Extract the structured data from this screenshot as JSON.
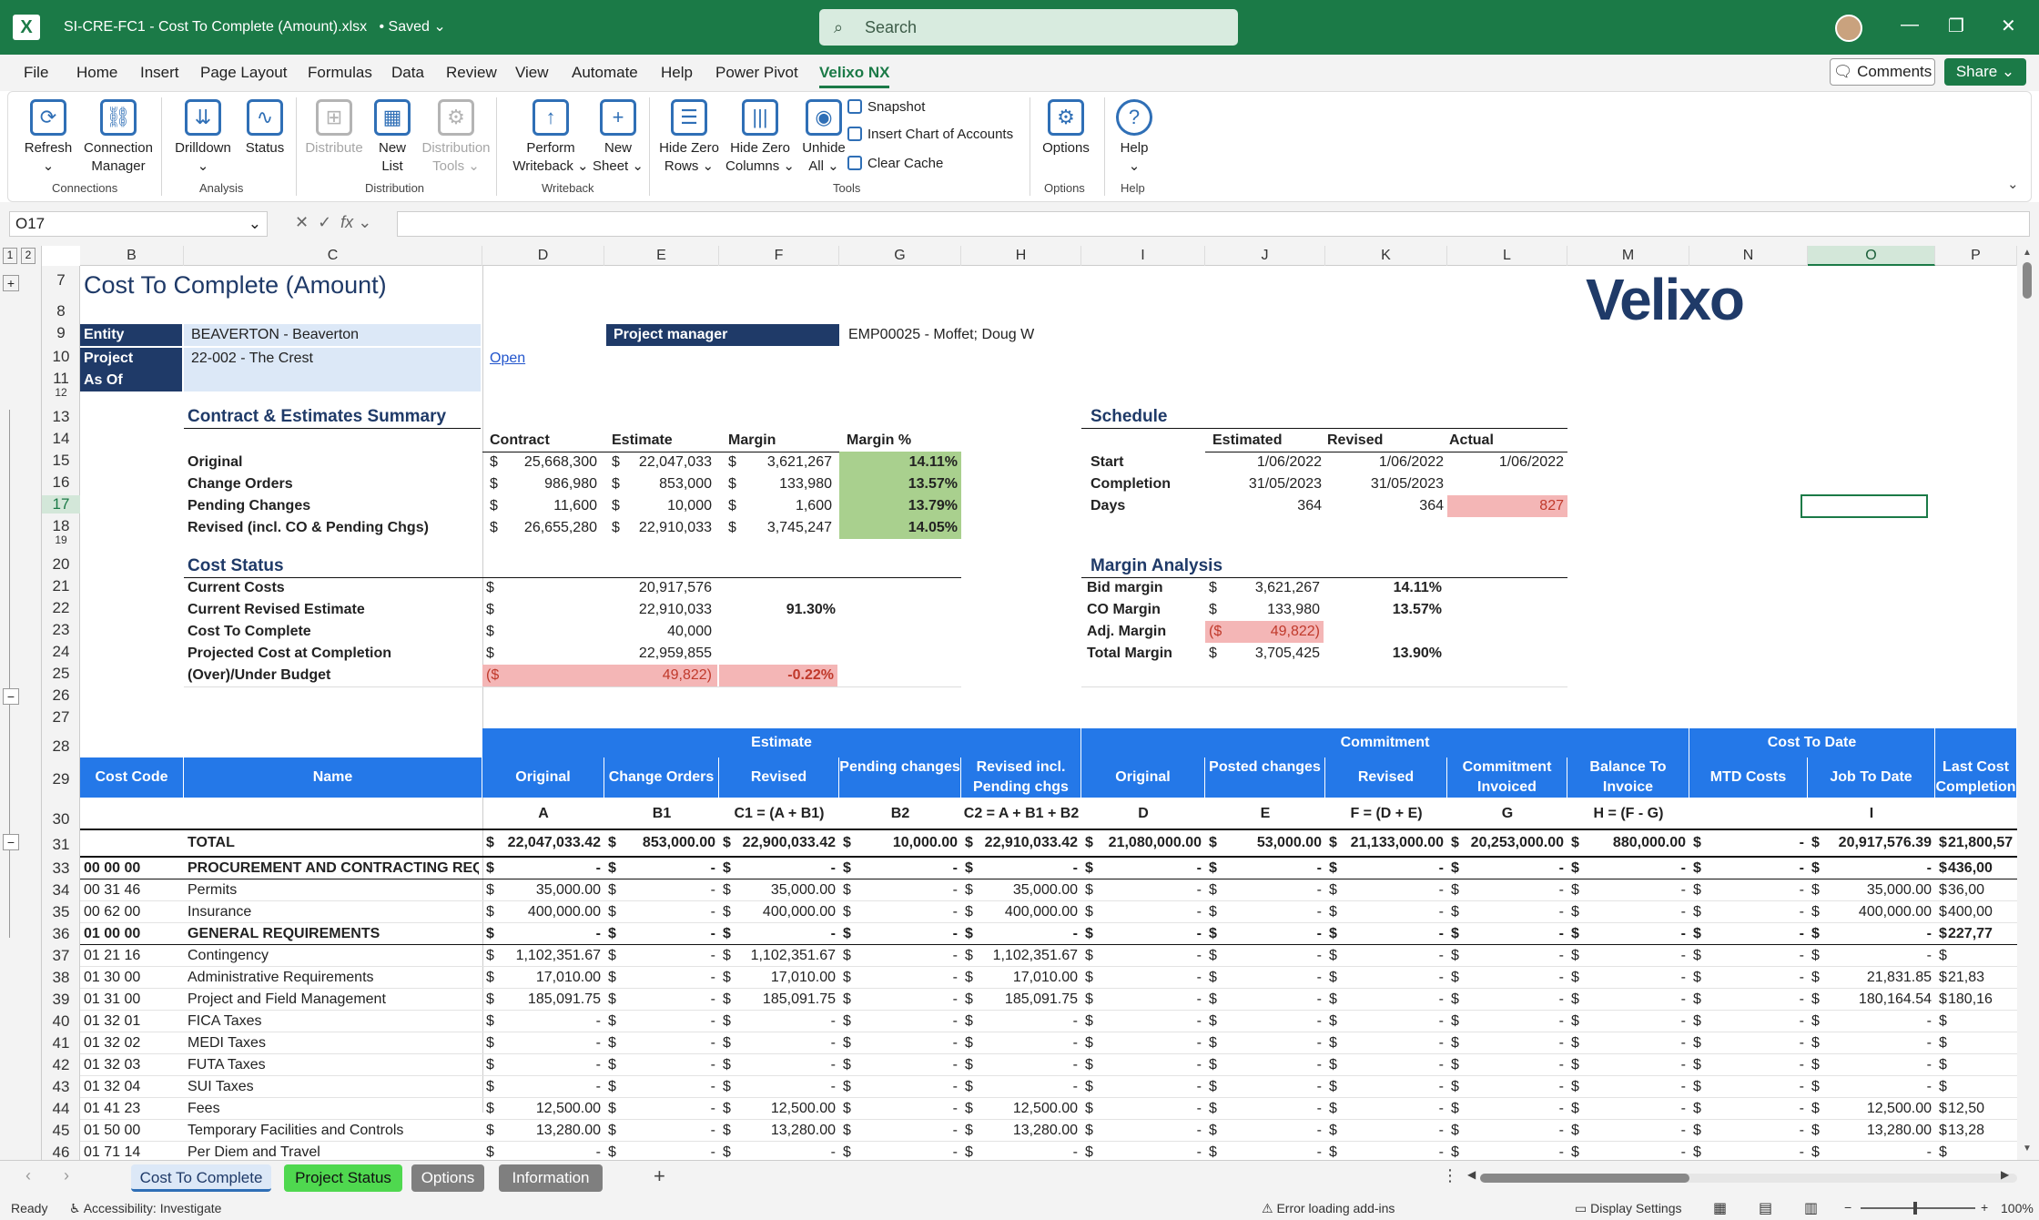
{
  "titlebar": {
    "app_icon": "excel-icon",
    "doc": "SI-CRE-FC1 - Cost To Complete (Amount).xlsx",
    "saved": "• Saved",
    "search": "Search"
  },
  "menu": [
    "File",
    "Home",
    "Insert",
    "Page Layout",
    "Formulas",
    "Data",
    "Review",
    "View",
    "Automate",
    "Help",
    "Power Pivot",
    "Velixo NX"
  ],
  "menu_active": "Velixo NX",
  "comments": "Comments",
  "share": "Share",
  "ribbon": {
    "refresh": "Refresh",
    "conn1": "Connection",
    "conn2": "Manager",
    "drilldown": "Drilldown",
    "status": "Status",
    "distribute": "Distribute",
    "newlist1": "New",
    "newlist2": "List",
    "dt1": "Distribution",
    "dt2": "Tools",
    "pw1": "Perform",
    "pw2": "Writeback",
    "ns1": "New",
    "ns2": "Sheet",
    "hzr1": "Hide Zero",
    "hzr2": "Rows",
    "hzc1": "Hide Zero",
    "hzc2": "Columns",
    "un1": "Unhide",
    "un2": "All",
    "snapshot": "Snapshot",
    "insert_coa": "Insert Chart of Accounts",
    "clear_cache": "Clear Cache",
    "options": "Options",
    "help": "Help",
    "groups": [
      "Connections",
      "Analysis",
      "Distribution",
      "Writeback",
      "Tools",
      "Options",
      "Help"
    ]
  },
  "namebox": "O17",
  "columns": [
    "B",
    "C",
    "D",
    "E",
    "F",
    "G",
    "H",
    "I",
    "J",
    "K",
    "L",
    "M",
    "N",
    "O",
    "P"
  ],
  "rows": [
    "7",
    "8",
    "9",
    "10",
    "11",
    "12",
    "13",
    "14",
    "15",
    "16",
    "17",
    "18",
    "19",
    "20",
    "21",
    "22",
    "23",
    "24",
    "25",
    "26",
    "27",
    "28",
    "29",
    "30",
    "31",
    "33",
    "34",
    "35",
    "36",
    "37",
    "38",
    "39",
    "40",
    "41",
    "42",
    "43",
    "44",
    "45",
    "46"
  ],
  "sheet": {
    "title": "Cost To Complete (Amount)",
    "logo": "Velixo",
    "entity_label": "Entity",
    "entity_value": "BEAVERTON - Beaverton",
    "project_label": "Project",
    "project_value": "22-002 - The Crest",
    "open_link": "Open",
    "asof_label": "As Of",
    "pm_label": "Project manager",
    "pm_value": "EMP00025 - Moffet; Doug W",
    "summary_title": "Contract & Estimates Summary",
    "summary_headers": [
      "Contract",
      "Estimate",
      "Margin",
      "Margin %"
    ],
    "summary_rows": [
      {
        "label": "Original",
        "contract": "25,668,300",
        "estimate": "22,047,033",
        "margin": "3,621,267",
        "pct": "14.11%"
      },
      {
        "label": "Change Orders",
        "contract": "986,980",
        "estimate": "853,000",
        "margin": "133,980",
        "pct": "13.57%"
      },
      {
        "label": "Pending Changes",
        "contract": "11,600",
        "estimate": "10,000",
        "margin": "1,600",
        "pct": "13.79%"
      },
      {
        "label": "Revised (incl. CO & Pending Chgs)",
        "contract": "26,655,280",
        "estimate": "22,910,033",
        "margin": "3,745,247",
        "pct": "14.05%"
      }
    ],
    "schedule_title": "Schedule",
    "schedule_headers": [
      "Estimated",
      "Revised",
      "Actual"
    ],
    "schedule_rows": [
      {
        "label": "Start",
        "est": "1/06/2022",
        "rev": "1/06/2022",
        "act": "1/06/2022"
      },
      {
        "label": "Completion",
        "est": "31/05/2023",
        "rev": "31/05/2023",
        "act": ""
      },
      {
        "label": "Days",
        "est": "364",
        "rev": "364",
        "act": "827"
      }
    ],
    "cost_status_title": "Cost Status",
    "cost_status": [
      {
        "label": "Current Costs",
        "value": "20,917,576",
        "pct": ""
      },
      {
        "label": "Current Revised Estimate",
        "value": "22,910,033",
        "pct": "91.30%"
      },
      {
        "label": "Cost To Complete",
        "value": "40,000",
        "pct": ""
      },
      {
        "label": "Projected Cost at Completion",
        "value": "22,959,855",
        "pct": ""
      },
      {
        "label": "(Over)/Under Budget",
        "value": "49,822)",
        "pct": "-0.22%"
      }
    ],
    "margin_title": "Margin Analysis",
    "margin_rows": [
      {
        "label": "Bid margin",
        "value": "3,621,267",
        "pct": "14.11%"
      },
      {
        "label": "CO Margin",
        "value": "133,980",
        "pct": "13.57%"
      },
      {
        "label": "Adj. Margin",
        "value": "49,822)",
        "pct": ""
      },
      {
        "label": "Total Margin",
        "value": "3,705,425",
        "pct": "13.90%"
      }
    ],
    "groups": [
      "Estimate",
      "Commitment",
      "Cost To Date"
    ],
    "headers": [
      "Cost Code",
      "Name",
      "Original",
      "Change Orders",
      "Revised",
      "Pending changes",
      "Revised incl. Pending chgs",
      "Original",
      "Posted changes",
      "Revised",
      "Commitment Invoiced",
      "Balance To Invoice",
      "MTD Costs",
      "Job To Date",
      "Last Cost Completion"
    ],
    "formulas": [
      "",
      "",
      "A",
      "B1",
      "C1 = (A + B1)",
      "B2",
      "C2 = A + B1 + B2",
      "D",
      "E",
      "F = (D + E)",
      "G",
      "H = (F - G)",
      "",
      "I",
      ""
    ],
    "total": [
      "",
      "TOTAL",
      "22,047,033.42",
      "853,000.00",
      "22,900,033.42",
      "10,000.00",
      "22,910,033.42",
      "21,080,000.00",
      "53,000.00",
      "21,133,000.00",
      "20,253,000.00",
      "880,000.00",
      "-",
      "20,917,576.39",
      "21,800,57"
    ],
    "lines": [
      [
        "00 00 00",
        "PROCUREMENT AND CONTRACTING REQU",
        "-",
        "-",
        "-",
        "-",
        "-",
        "-",
        "-",
        "-",
        "-",
        "-",
        "-",
        "-",
        "436,00"
      ],
      [
        "00 31 46",
        "Permits",
        "35,000.00",
        "-",
        "35,000.00",
        "-",
        "35,000.00",
        "-",
        "-",
        "-",
        "-",
        "-",
        "-",
        "35,000.00",
        "36,00"
      ],
      [
        "00 62 00",
        "Insurance",
        "400,000.00",
        "-",
        "400,000.00",
        "-",
        "400,000.00",
        "-",
        "-",
        "-",
        "-",
        "-",
        "-",
        "400,000.00",
        "400,00"
      ],
      [
        "01 00 00",
        "GENERAL REQUIREMENTS",
        "-",
        "-",
        "-",
        "-",
        "-",
        "-",
        "-",
        "-",
        "-",
        "-",
        "-",
        "-",
        "227,77"
      ],
      [
        "01 21 16",
        "Contingency",
        "1,102,351.67",
        "-",
        "1,102,351.67",
        "-",
        "1,102,351.67",
        "-",
        "-",
        "-",
        "-",
        "-",
        "-",
        "-",
        ""
      ],
      [
        "01 30 00",
        "Administrative Requirements",
        "17,010.00",
        "-",
        "17,010.00",
        "-",
        "17,010.00",
        "-",
        "-",
        "-",
        "-",
        "-",
        "-",
        "21,831.85",
        "21,83"
      ],
      [
        "01 31 00",
        "Project and Field Management",
        "185,091.75",
        "-",
        "185,091.75",
        "-",
        "185,091.75",
        "-",
        "-",
        "-",
        "-",
        "-",
        "-",
        "180,164.54",
        "180,16"
      ],
      [
        "01 32 01",
        "FICA Taxes",
        "-",
        "-",
        "-",
        "-",
        "-",
        "-",
        "-",
        "-",
        "-",
        "-",
        "-",
        "-",
        ""
      ],
      [
        "01 32 02",
        "MEDI Taxes",
        "-",
        "-",
        "-",
        "-",
        "-",
        "-",
        "-",
        "-",
        "-",
        "-",
        "-",
        "-",
        ""
      ],
      [
        "01 32 03",
        "FUTA Taxes",
        "-",
        "-",
        "-",
        "-",
        "-",
        "-",
        "-",
        "-",
        "-",
        "-",
        "-",
        "-",
        ""
      ],
      [
        "01 32 04",
        "SUI Taxes",
        "-",
        "-",
        "-",
        "-",
        "-",
        "-",
        "-",
        "-",
        "-",
        "-",
        "-",
        "-",
        ""
      ],
      [
        "01 41 23",
        "Fees",
        "12,500.00",
        "-",
        "12,500.00",
        "-",
        "12,500.00",
        "-",
        "-",
        "-",
        "-",
        "-",
        "-",
        "12,500.00",
        "12,50"
      ],
      [
        "01 50 00",
        "Temporary Facilities and Controls",
        "13,280.00",
        "-",
        "13,280.00",
        "-",
        "13,280.00",
        "-",
        "-",
        "-",
        "-",
        "-",
        "-",
        "13,280.00",
        "13,28"
      ],
      [
        "01 71 14",
        "Per Diem and Travel",
        "-",
        "-",
        "-",
        "-",
        "-",
        "-",
        "-",
        "-",
        "-",
        "-",
        "-",
        "-",
        ""
      ]
    ]
  },
  "tabs": [
    "Cost To Complete",
    "Project Status",
    "Options",
    "Information"
  ],
  "status": {
    "ready": "Ready",
    "accessibility": "Accessibility: Investigate",
    "addins": "Error loading add-ins",
    "display": "Display Settings",
    "zoom": "100%"
  }
}
